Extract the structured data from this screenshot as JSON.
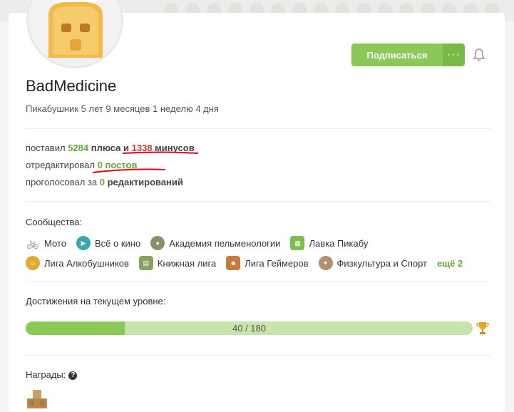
{
  "profile": {
    "name": "BadMedicine",
    "tenure": "Пикабушник 5 лет 9 месяцев 1 неделю 4 дня"
  },
  "actions": {
    "subscribe_label": "Подписаться",
    "more_label": "···"
  },
  "stats": {
    "line1_pre": "поставил",
    "pluses": "5284",
    "line1_mid": "плюса и",
    "minuses": "1338",
    "line1_post": "минусов",
    "line2_pre": "отредактировал",
    "posts": "0 постов",
    "line3_pre": "проголосовал за",
    "edits_count": "0",
    "line3_post": "редактирований"
  },
  "communities": {
    "title": "Сообщества:",
    "row1": [
      {
        "label": "Мото",
        "icon": "motorbike-icon",
        "color": "#222222"
      },
      {
        "label": "Всё о кино",
        "icon": "cinema-icon",
        "color": "#3aa6a6"
      },
      {
        "label": "Академия пельменологии",
        "icon": "dumpling-icon",
        "color": "#8a8f6a"
      },
      {
        "label": "Лавка Пикабу",
        "icon": "shop-icon",
        "color": "#7bbf4a"
      }
    ],
    "row2": [
      {
        "label": "Лига Алкобушников",
        "icon": "beer-icon",
        "color": "#e0a82e"
      },
      {
        "label": "Книжная лига",
        "icon": "book-icon",
        "color": "#8aa060"
      },
      {
        "label": "Лига Геймеров",
        "icon": "gamer-icon",
        "color": "#c87a3a"
      },
      {
        "label": "Физкультура и Спорт",
        "icon": "sport-icon",
        "color": "#b0906a"
      }
    ],
    "more_label": "ещё 2"
  },
  "achievements": {
    "title": "Достижения на текущем уровне:",
    "progress_label": "40 / 180",
    "current": 40,
    "total": 180
  },
  "awards": {
    "title": "Награды:"
  },
  "colors": {
    "accent": "#8ac858",
    "plus": "#6aa83a",
    "minus": "#d0342c"
  }
}
